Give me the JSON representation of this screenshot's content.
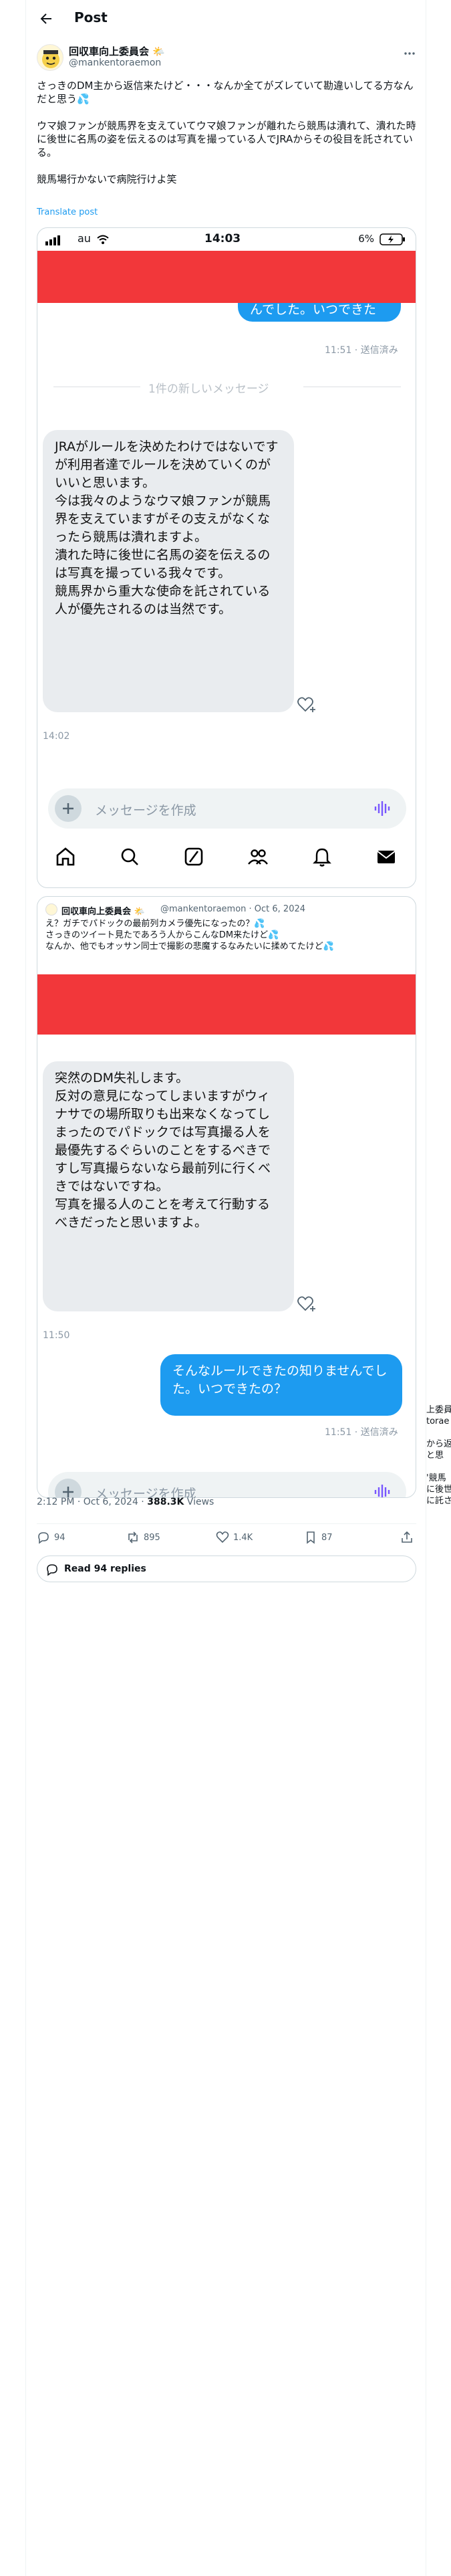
{
  "header": {
    "title": "Post"
  },
  "author": {
    "name": "回収車向上委員会",
    "handle": "@mankentoraemon"
  },
  "tweet": {
    "text": "さっきのDM主から返信来たけど・・・なんか全てがズレていて勘違いしてる方なんだと思う💦\n\nウマ娘ファンが競馬界を支えていてウマ娘ファンが離れたら競馬は潰れて、潰れた時に後世に名馬の姿を伝えるのは写真を撮っている人でJRAからその役目を託されている。\n\n競馬場行かないで病院行けよ笑",
    "translate": "Translate post"
  },
  "screenshot1": {
    "carrier": "au",
    "time": "14:03",
    "battery": "6%",
    "top_bubble_partial": "ルールできたの知りま\nんでした。いつできたの？",
    "top_meta": "11:51 · 送信済み",
    "new_message": "1件の新しいメッセージ",
    "reply": "JRAがルールを決めたわけではないですが利用者達でルールを決めていくのがいいと思います。\n今は我々のようなウマ娘ファンが競馬界を支えていますがその支えがなくなったら競馬は潰れますよ。\n潰れた時に後世に名馬の姿を伝えるのは写真を撮っている我々です。\n競馬界から重大な使命を託されている人が優先されるのは当然です。",
    "reply_time": "14:02",
    "composer_placeholder": "メッセージを作成"
  },
  "quote": {
    "name": "回収車向上委員会",
    "handle_date": "@mankentoraemon · Oct 6, 2024",
    "text": "え？ガチでパドックの最前列カメラ優先になったの？💦\nさっきのツイート見たであろう人からこんなDM来たけど💦\nなんか、他でもオッサン同士で撮影の悲魔するなみたいに揉めてたけど💦"
  },
  "screenshot2": {
    "message_in": "突然のDM失礼します。\n反対の意見になってしまいますがウィナサでの場所取りも出来なくなってしまったのでパドックでは写真撮る人を最優先するぐらいのことをするべきですし写真撮らないなら最前列に行くべきではないですね。\n写真を撮る人のことを考えて行動するべきだったと思いますよ。",
    "message_in_time": "11:50",
    "message_out": "そんなルールできたの知りませんでした。いつできたの？",
    "message_out_meta": "11:51 · 送信済み",
    "composer_placeholder": "メッセージを作成"
  },
  "post_meta": {
    "time": "2:12 PM · Oct 6, 2024 · ",
    "views_count": "388.3K",
    "views_label": " Views"
  },
  "actions": {
    "replies": "94",
    "reposts": "895",
    "likes": "1.4K",
    "bookmarks": "87"
  },
  "read_replies": "Read 94 replies",
  "ghost_text": "上委員\ntorae\n\nから返\nと思\n\n'競馬\nに後世\nに託さ"
}
